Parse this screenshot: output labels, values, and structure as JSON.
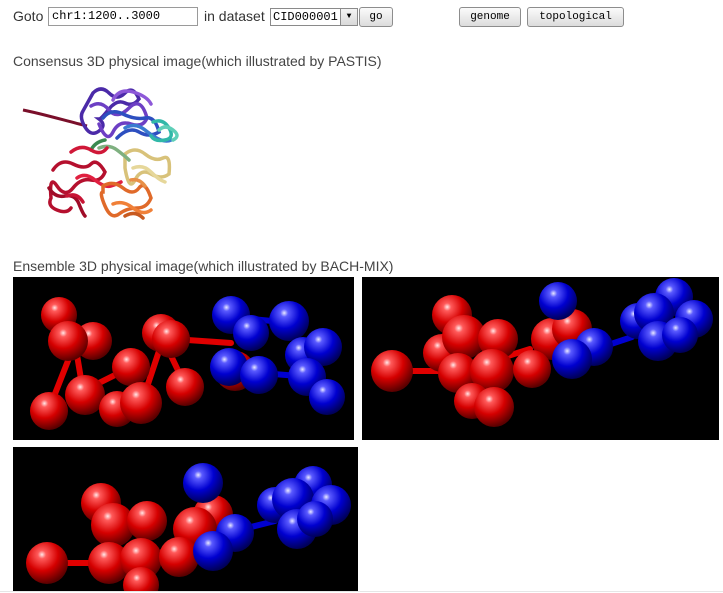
{
  "toolbar": {
    "goto_label": "Goto",
    "goto_value": "chr1:1200..3000",
    "dataset_label": "in dataset",
    "dataset_selected": "CID000001",
    "go_button": "go",
    "genome_button": "genome",
    "topological_button": "topological"
  },
  "consensus": {
    "title": "Consensus 3D physical image(which illustrated by PASTIS)"
  },
  "ensemble": {
    "title": "Ensemble 3D physical image(which illustrated by BACH-MIX)"
  },
  "colors": {
    "red_sphere": "#e00000",
    "blue_sphere": "#0000e0",
    "panel_bg": "#000000"
  }
}
